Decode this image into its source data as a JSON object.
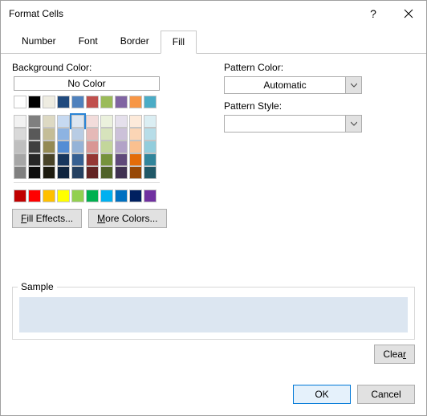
{
  "title": "Format Cells",
  "tabs": [
    "Number",
    "Font",
    "Border",
    "Fill"
  ],
  "active_tab": 3,
  "labels": {
    "background_color": "Background Color:",
    "no_color": "No Color",
    "pattern_color": "Pattern Color:",
    "pattern_style": "Pattern Style:",
    "sample": "Sample"
  },
  "buttons": {
    "fill_effects_pre": "F",
    "fill_effects_post": "ill Effects...",
    "more_colors_pre": "",
    "more_colors_u": "M",
    "more_colors_post": "ore Colors...",
    "clear": "Clea",
    "clear_u": "r",
    "ok": "OK",
    "cancel": "Cancel"
  },
  "pattern_color_value": "Automatic",
  "pattern_style_value": "",
  "sample_color": "#dce6f1",
  "theme_colors_row1": [
    "#ffffff",
    "#000000",
    "#eeece1",
    "#1f497d",
    "#4f81bd",
    "#c0504d",
    "#9bbb59",
    "#8064a2",
    "#f79646",
    "#4bacc6"
  ],
  "theme_shades": [
    [
      "#f2f2f2",
      "#7f7f7f",
      "#ddd9c3",
      "#c6d9f1",
      "#dce6f1",
      "#f2dcdb",
      "#ebf1dd",
      "#e5e0ec",
      "#fdeada",
      "#dbeef3"
    ],
    [
      "#d9d9d9",
      "#595959",
      "#c4bd97",
      "#8db3e2",
      "#b8cce4",
      "#e5b9b7",
      "#d7e3bc",
      "#ccc1d9",
      "#fbd5b5",
      "#b7dde8"
    ],
    [
      "#bfbfbf",
      "#404040",
      "#948a54",
      "#548dd4",
      "#95b3d7",
      "#d99694",
      "#c3d69b",
      "#b2a2c7",
      "#fac08f",
      "#92cddc"
    ],
    [
      "#a6a6a6",
      "#262626",
      "#494429",
      "#17365d",
      "#366092",
      "#953734",
      "#76923c",
      "#5f497a",
      "#e36c09",
      "#31859b"
    ],
    [
      "#808080",
      "#0d0d0d",
      "#1d1b10",
      "#0f243e",
      "#244061",
      "#632423",
      "#4f6128",
      "#3f3151",
      "#974806",
      "#205867"
    ]
  ],
  "standard_colors": [
    "#c00000",
    "#ff0000",
    "#ffc000",
    "#ffff00",
    "#92d050",
    "#00b050",
    "#00b0f0",
    "#0070c0",
    "#002060",
    "#7030a0"
  ],
  "selected_swatch": {
    "group": "shade",
    "row": 0,
    "col": 4
  }
}
